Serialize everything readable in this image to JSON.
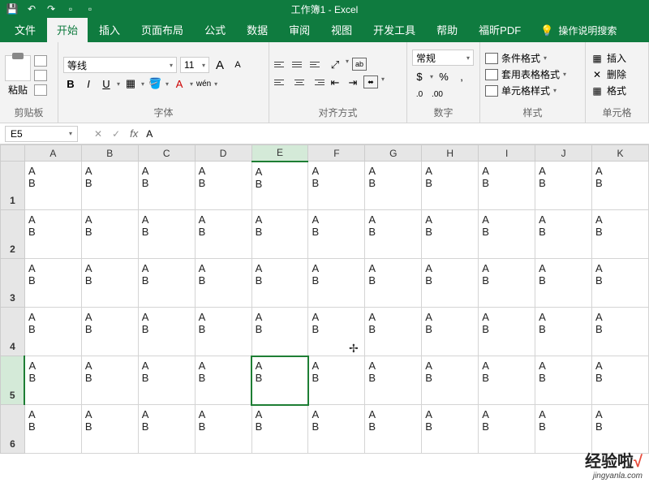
{
  "title": "工作簿1 - Excel",
  "tabs": {
    "file": "文件",
    "home": "开始",
    "insert": "插入",
    "layout": "页面布局",
    "formulas": "公式",
    "data": "数据",
    "review": "审阅",
    "view": "视图",
    "dev": "开发工具",
    "help": "帮助",
    "foxit": "福昕PDF"
  },
  "tell_me": "操作说明搜索",
  "ribbon": {
    "clipboard": {
      "label": "剪贴板",
      "paste": "粘贴"
    },
    "font": {
      "label": "字体",
      "name": "等线",
      "size": "11",
      "bold": "B",
      "italic": "I",
      "underline": "U",
      "grow": "A",
      "shrink": "A",
      "ruby": "wén"
    },
    "alignment": {
      "label": "对齐方式"
    },
    "number": {
      "label": "数字",
      "format": "常规",
      "currency": "$",
      "percent": "%",
      "comma": ",",
      "inc": ".0",
      "dec": ".00"
    },
    "styles": {
      "label": "样式",
      "cond": "条件格式",
      "table": "套用表格格式",
      "cell": "单元格样式"
    },
    "cells": {
      "label": "单元格",
      "insert": "插入",
      "delete": "删除",
      "format": "格式"
    }
  },
  "name_box": "E5",
  "formula_value": "A",
  "columns": [
    "A",
    "B",
    "C",
    "D",
    "E",
    "F",
    "G",
    "H",
    "I",
    "J",
    "K"
  ],
  "active_col": "E",
  "active_row": 5,
  "rows": [
    1,
    2,
    3,
    4,
    5,
    6
  ],
  "cell_content": "A\nB",
  "watermark": {
    "main1": "经验啦",
    "main2": "√",
    "sub": "jingyanla.com"
  }
}
